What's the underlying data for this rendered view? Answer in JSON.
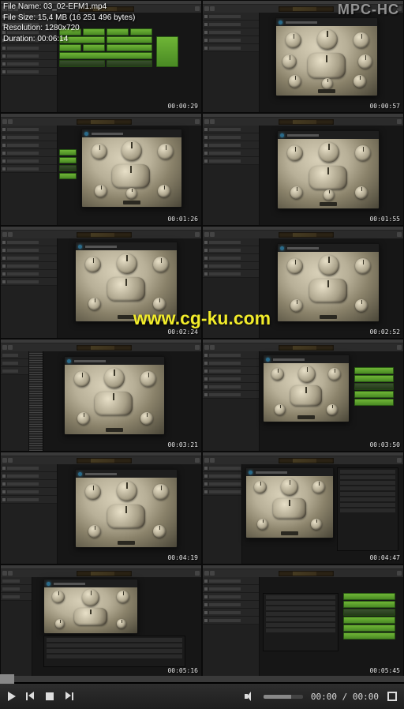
{
  "app_title": "MPC-HC",
  "info": {
    "filename_label": "File Name:",
    "filename": "03_02-EFM1.mp4",
    "filesize_label": "File Size:",
    "filesize": "15,4 MB (16 251 496 bytes)",
    "resolution_label": "Resolution:",
    "resolution": "1280x720",
    "duration_label": "Duration:",
    "duration": "00:06:14"
  },
  "watermark": "www.cg-ku.com",
  "thumbnails": [
    {
      "ts": "00:00:29"
    },
    {
      "ts": "00:00:57"
    },
    {
      "ts": "00:01:26"
    },
    {
      "ts": "00:01:55"
    },
    {
      "ts": "00:02:24"
    },
    {
      "ts": "00:02:52"
    },
    {
      "ts": "00:03:21"
    },
    {
      "ts": "00:03:50"
    },
    {
      "ts": "00:04:19"
    },
    {
      "ts": "00:04:47"
    },
    {
      "ts": "00:05:16"
    },
    {
      "ts": "00:05:45"
    }
  ],
  "player": {
    "current_time": "00:00",
    "total_time": "00:00"
  }
}
